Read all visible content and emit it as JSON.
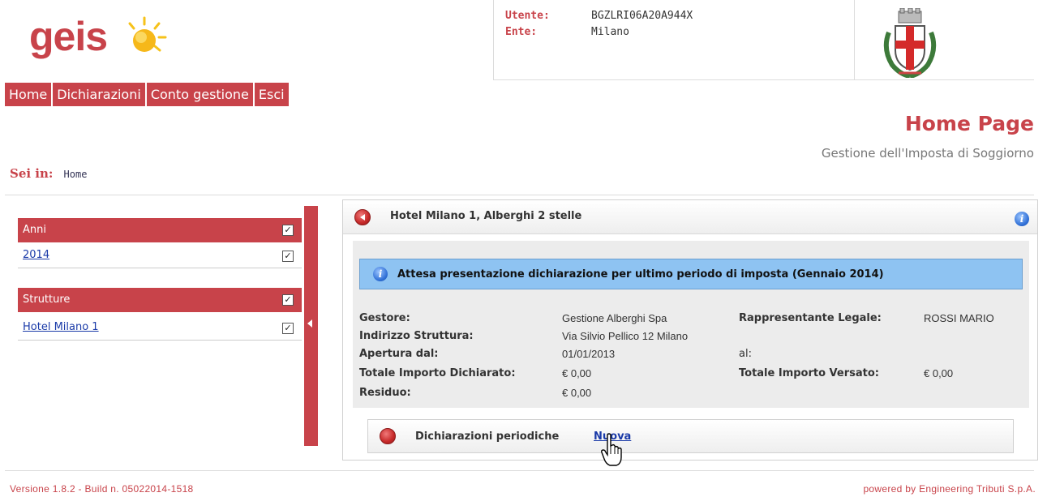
{
  "brand": {
    "logo_text": "geis"
  },
  "user_info": {
    "user_label": "Utente:",
    "user_value": "BGZLRI06A20A944X",
    "ente_label": "Ente:",
    "ente_value": "Milano"
  },
  "nav": {
    "items": [
      "Home",
      "Dichiarazioni",
      "Conto gestione",
      "Esci"
    ]
  },
  "page": {
    "title": "Home Page",
    "subtitle": "Gestione dell'Imposta di Soggiorno"
  },
  "breadcrumb": {
    "label": "Sei in:",
    "current": "Home"
  },
  "sidebar": {
    "years": {
      "header": "Anni",
      "items": [
        "2014"
      ]
    },
    "structures": {
      "header": "Strutture",
      "items": [
        "Hotel Milano 1"
      ]
    }
  },
  "panel": {
    "title": "Hotel Milano 1, Alberghi 2 stelle",
    "status": "Attesa presentazione dichiarazione per ultimo periodo di imposta (Gennaio 2014)",
    "fields": {
      "gestore_label": "Gestore:",
      "gestore_value": "Gestione Alberghi Spa",
      "rappresentante_label": "Rappresentante Legale:",
      "rappresentante_value": "ROSSI MARIO",
      "indirizzo_label": "Indirizzo Struttura:",
      "indirizzo_value": "Via Silvio Pellico 12 Milano",
      "apertura_label": "Apertura dal:",
      "apertura_value": "01/01/2013",
      "al_label": "al:",
      "totale_dichiarato_label": "Totale Importo Dichiarato:",
      "totale_dichiarato_value": "€ 0,00",
      "totale_versato_label": "Totale Importo Versato:",
      "totale_versato_value": "€ 0,00",
      "residuo_label": "Residuo:",
      "residuo_value": "€ 0,00"
    },
    "sub_panel": {
      "title": "Dichiarazioni periodiche",
      "link": "Nuova"
    }
  },
  "footer": {
    "version": "Versione 1.8.2 - Build n. 05022014-1518",
    "powered": "powered by Engineering Tributi S.p.A."
  },
  "colors": {
    "accent": "#c8434a",
    "status_bg": "#8ec3f2",
    "link": "#1a3aa8"
  }
}
